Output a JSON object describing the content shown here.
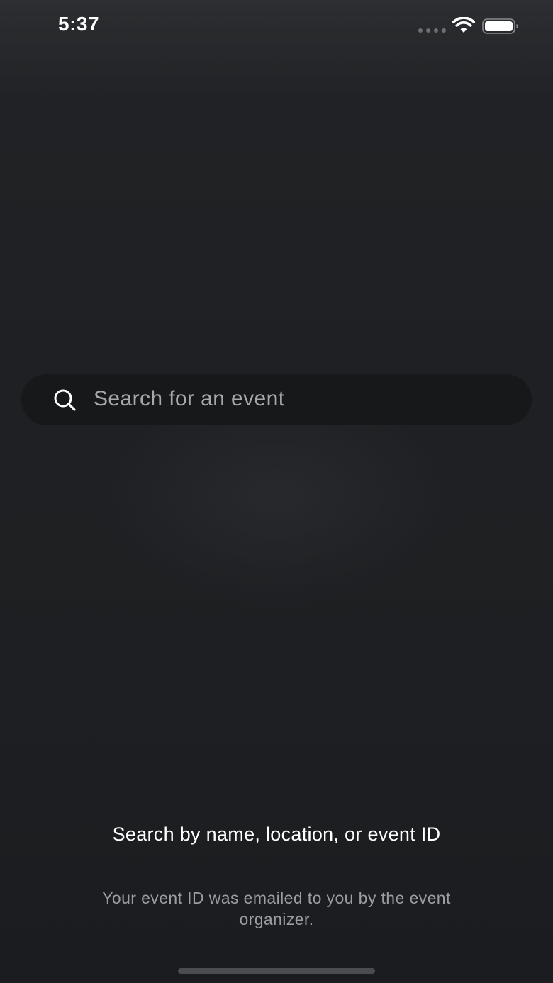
{
  "status_bar": {
    "time": "5:37",
    "icons": [
      "cellular-signal-icon",
      "wifi-icon",
      "battery-icon"
    ],
    "battery_level": 1.0
  },
  "search": {
    "placeholder": "Search for an event",
    "value": "",
    "icon": "search-icon"
  },
  "hint": {
    "title": "Search by name, location, or event ID",
    "subtitle": "Your event ID was emailed to you by the event organizer."
  },
  "colors": {
    "background": "#1e2023",
    "search_bar": "#17181a",
    "placeholder": "#a7a8ab",
    "title_text": "#ffffff",
    "subtitle_text": "#9c9da0"
  }
}
